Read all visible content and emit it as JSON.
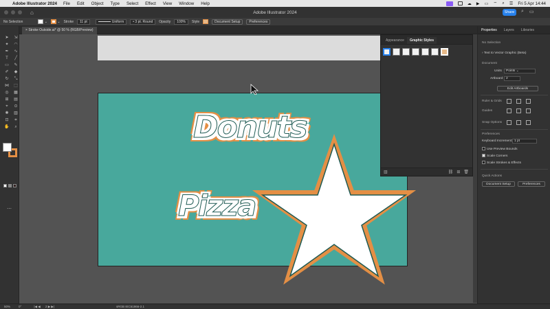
{
  "menubar": {
    "app_name": "Adobe Illustrator 2024",
    "items": [
      "File",
      "Edit",
      "Object",
      "Type",
      "Select",
      "Effect",
      "View",
      "Window",
      "Help"
    ],
    "datetime": "Fri 5 Apr  14:44"
  },
  "titlebar": {
    "title": "Adobe Illustrator 2024",
    "share_label": "Share"
  },
  "controlbar": {
    "selection": "No Selection",
    "stroke_label": "Stroke",
    "stroke_weight": "11 pt",
    "profile": "Uniform",
    "brush": "3 pt. Round",
    "opacity_label": "Opacity",
    "opacity_value": "100%",
    "style_label": "Style",
    "document_setup": "Document Setup",
    "preferences": "Preferences",
    "colors": {
      "stroke": "#e48f45"
    }
  },
  "document": {
    "tab_label": "Stroke Outside.ai* @ 50 % (RGB/Preview)"
  },
  "artwork": {
    "text1": "Donuts",
    "text2": "Pizza",
    "colors": {
      "artboard": "#48a89c",
      "fill": "#ffffff",
      "stroke": "#e48f45"
    }
  },
  "graphic_styles_panel": {
    "tabs": [
      "Appearance",
      "Graphic Styles"
    ],
    "active_tab": "Graphic Styles"
  },
  "properties_panel": {
    "tabs": [
      "Properties",
      "Layers",
      "Libraries"
    ],
    "selection": "No Selection",
    "text_to_vector": "Text to Vector Graphic (Beta)",
    "document_heading": "Document",
    "units_label": "Units",
    "units_value": "Points",
    "artboard_label": "Artboard",
    "artboard_value": "2",
    "edit_artboards": "Edit Artboards",
    "rulers_grids": "Ruler & Grids",
    "guides": "Guides",
    "snap_options": "Snap Options",
    "preferences_heading": "Preferences",
    "keyboard_increment_label": "Keyboard Increment:",
    "keyboard_increment_value": "1 pt",
    "use_preview_bounds": "Use Preview Bounds",
    "scale_corners": "Scale Corners",
    "scale_strokes": "Scale Strokes & Effects",
    "quick_actions": "Quick Actions",
    "document_setup": "Document Setup",
    "preferences": "Preferences"
  },
  "statusbar": {
    "zoom": "50%",
    "rotation": "0°",
    "artboard_nav": "2",
    "color_mode": "sRGB IEC61966-2.1"
  }
}
